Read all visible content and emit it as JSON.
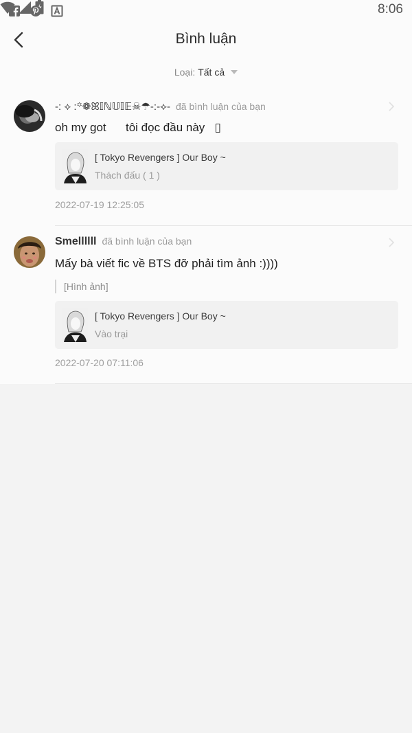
{
  "status_bar": {
    "time": "8:06",
    "left_icons": [
      "facebook-icon",
      "pinterest-icon",
      "a-app-icon"
    ],
    "right_icons": [
      "wifi-icon",
      "signal-icon",
      "battery-icon"
    ]
  },
  "header": {
    "title": "Bình luận",
    "back_icon": "back-arrow-icon"
  },
  "filter": {
    "label": "Loại:",
    "value": "Tất cả"
  },
  "comments": [
    {
      "username": "-: ⟡ :꙳❁ꕤ𝕀ℕ𝕌𝕀𝔼☠︎☂︎-:-⟡-",
      "action": "đã bình luận của bạn",
      "text": "oh my got      tôi đọc đầu này   ▯",
      "quote": "",
      "card_title": "[ Tokyo Revengers ] Our Boy ~",
      "card_subtitle": "Thách đấu ( 1 )",
      "timestamp": "2022-07-19 12:25:05"
    },
    {
      "username": "Smellllll",
      "action": "đã bình luận của bạn",
      "text": "Mấy bà viết fic về BTS đỡ phải tìm ảnh :))))",
      "quote": "[Hình ảnh]",
      "card_title": "[ Tokyo Revengers ] Our Boy ~",
      "card_subtitle": "Vào trại",
      "timestamp": "2022-07-20 07:11:06"
    }
  ],
  "colors": {
    "background": "#f3f3f3",
    "surface": "#fbfbfb",
    "card": "#f1f1f1",
    "muted_text": "#9a9a9a"
  }
}
